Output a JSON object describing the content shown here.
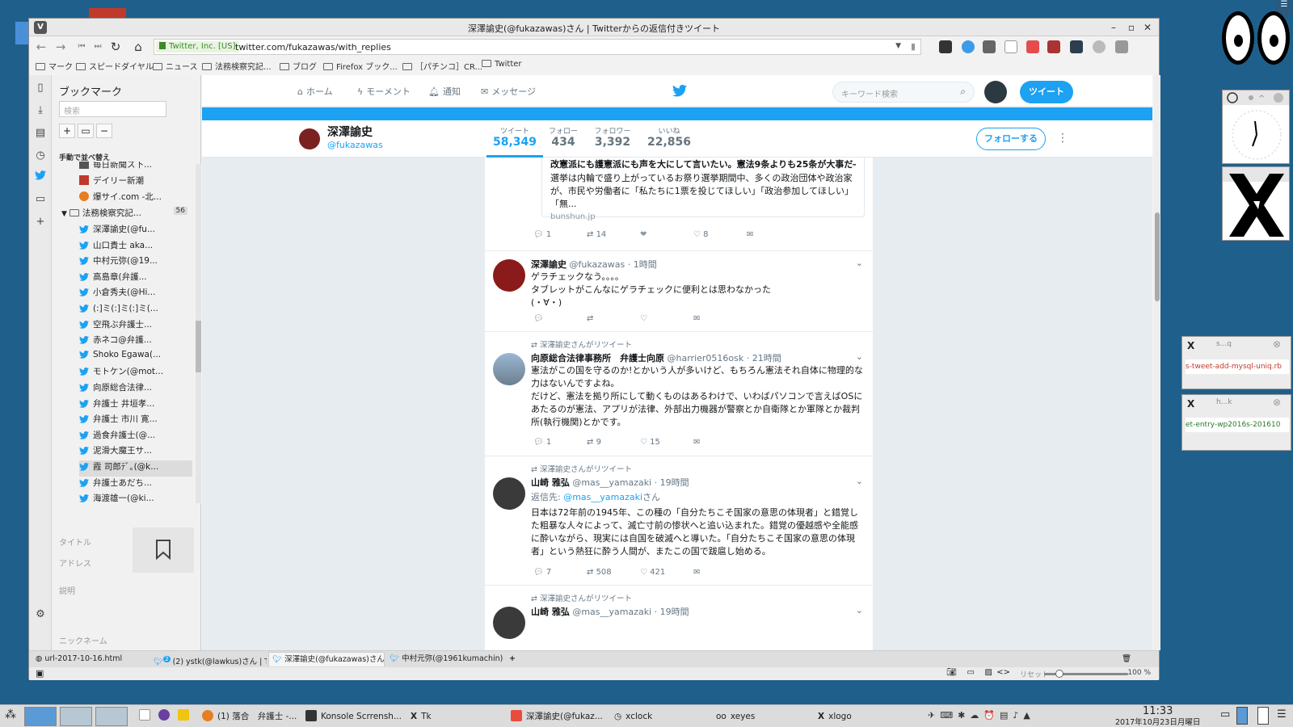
{
  "window": {
    "title": "深澤諭史(@fukazawas)さん | Twitterからの返信付きツイート"
  },
  "address": {
    "secure_label": "Twitter, Inc. [US]",
    "url": "twitter.com/fukazawas/with_replies"
  },
  "bookmarks_bar": [
    "マーク",
    "スピードダイヤル",
    "ニュース",
    "法務検察究記...",
    "ブログ",
    "Firefox ブック...",
    "［パチンコ］CR...",
    "Twitter"
  ],
  "bookmark_panel": {
    "title": "ブックマーク",
    "search_placeholder": "検索",
    "sort_label": "手動で並べ替え",
    "folder_name": "法務検察究記...",
    "folder_count": "56",
    "items_top": [
      "毎日新聞ス下...",
      "デイリー新潮",
      "爆サイ.com -北..."
    ],
    "items": [
      "深澤諭史(@fu...",
      "山口貴士 aka...",
      "中村元弥(@19...",
      "高島章(弁護...",
      "小倉秀夫(@Hi...",
      "(:]ミ(:]ミ(:]ミ(...",
      "空飛ぶ弁護士...",
      "赤ネコ@弁護...",
      "Shoko Egawa(...",
      "モトケン(@mot...",
      "向原総合法律...",
      "弁護士 井垣孝...",
      "弁護士 市川 寛...",
      "過食弁護士(@...",
      "泥滑大魔王サ...",
      "霞 司郎ﾃﾞ｡(@k...",
      "弁護士あだち...",
      "海渡雄一(@ki..."
    ],
    "field_title": "タイトル",
    "field_address": "アドレス",
    "field_desc": "説明",
    "field_nick": "ニックネーム"
  },
  "twitter_nav": {
    "home": "ホーム",
    "moments": "モーメント",
    "notifications": "通知",
    "messages": "メッセージ",
    "search_placeholder": "キーワード検索",
    "tweet_button": "ツイート"
  },
  "profile": {
    "name": "深澤諭史",
    "handle": "@fukazawas",
    "stats": [
      {
        "label": "ツイート",
        "value": "58,349"
      },
      {
        "label": "フォロー",
        "value": "434"
      },
      {
        "label": "フォロワー",
        "value": "3,392"
      },
      {
        "label": "いいね",
        "value": "22,856"
      }
    ],
    "follow_button": "フォローする"
  },
  "card": {
    "title": "改憲派にも護憲派にも声を大にして言いたい。憲法9条よりも25条が大事だ―...",
    "desc": "選挙は内輪で盛り上がっているお祭り選挙期間中、多くの政治団体や政治家が、市民や労働者に「私たちに1票を投じてほしい」「政治参加してほしい」「無...",
    "domain": "bunshun.jp",
    "reply": "1",
    "retweet": "14",
    "like": "8"
  },
  "tweets": [
    {
      "name": "深澤諭史",
      "meta": "@fukazawas · 1時間",
      "body": "ゲラチェックなう。。。。\nタブレットがこんなにゲラチェックに便利とは思わなかった\n(・∀・)",
      "reply": "",
      "retweet": "",
      "like": ""
    },
    {
      "rt": "深澤諭史さんがリツイート",
      "name": "向原総合法律事務所　弁護士向原",
      "meta": "@harrier0516osk · 21時間",
      "body": "憲法がこの国を守るのか!とかいう人が多いけど、もちろん憲法それ自体に物理的な力はないんですよね。\nだけど、憲法を拠り所にして動くものはあるわけで、いわばパソコンで言えばOSにあたるのが憲法、アプリが法律、外部出力機器が警察とか自衛隊とか軍隊とか裁判所(執行機関)とかです。",
      "reply": "1",
      "retweet": "9",
      "like": "15"
    },
    {
      "rt": "深澤諭史さんがリツイート",
      "name": "山崎 雅弘",
      "meta": "@mas__yamazaki · 19時間",
      "reply_to_prefix": "返信先: ",
      "reply_to": "@mas__yamazaki",
      "reply_to_suffix": "さん",
      "body": "日本は72年前の1945年、この種の「自分たちこそ国家の意思の体現者」と錯覚した粗暴な人々によって、滅亡寸前の惨状へと追い込まれた。錯覚の優越感や全能感に酔いながら、現実には自国を破滅へと導いた。「自分たちこそ国家の意思の体現者」という熱狂に酔う人間が、またこの国で跋扈し始める。",
      "reply": "7",
      "retweet": "508",
      "like": "421"
    },
    {
      "rt": "深澤諭史さんがリツイート",
      "name": "山崎 雅弘",
      "meta": "@mas__yamazaki · 19時間"
    }
  ],
  "tabs": [
    "url-2017-10-16.html",
    "(2) ystk(@lawkus)さん | Twit",
    "深澤諭史(@fukazawas)さん |",
    "中村元弥(@1961kumachin)"
  ],
  "tab_badge": "2",
  "status": {
    "reset": "リセット",
    "zoom": "100 %"
  },
  "konsole": [
    "s...q",
    "s-tweet-add-mysql-uniq.rb",
    "h...k",
    "et-entry-wp2016s-201610"
  ],
  "taskbar": {
    "items": [
      "(1) 落合　弁護士 -...",
      "Konsole Scrrensh...",
      "Tk",
      "深澤諭史(@fukaz...",
      "xclock",
      "xeyes",
      "xlogo"
    ],
    "time": "11:33",
    "date": "2017年10月23日月曜日"
  },
  "colors": {
    "twitter_blue": "#1da1f2",
    "desktop": "#1f5f8b"
  }
}
